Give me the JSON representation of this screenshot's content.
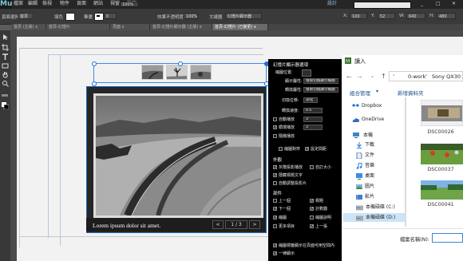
{
  "app": {
    "logo": "Mu"
  },
  "menubar": {
    "items": [
      "檔案",
      "編輯",
      "檢視",
      "物件",
      "頁面",
      "網站",
      "視窗",
      "說明"
    ],
    "workspace": "設計",
    "zoom": "100%",
    "right_field": "",
    "window_controls": [
      "_",
      "□",
      "✕"
    ]
  },
  "controlbar": {
    "page_label": "頁面選擇",
    "page_value": "首頁",
    "fill_label": "填色",
    "stroke_label": "筆畫",
    "stroke_value": "0",
    "effects_label": "效果",
    "opacity_label": "不透明度",
    "opacity_value": "100%",
    "wrap_label": "文繞圖",
    "widget_value": "幻燈片顯示器",
    "x_label": "X:",
    "x_value": "100",
    "y_label": "Y:",
    "y_value": "52",
    "w_label": "W:",
    "w_value": "640",
    "h_label": "H:",
    "h_value": "480"
  },
  "tabs": [
    "首頁 (主版) x",
    "首頁-幻燈片",
    "頁面 x",
    "首頁-幻燈片顯示器 (主版) x",
    "首頁-幻燈片 (已變更) x"
  ],
  "slideshow": {
    "caption": "Lorem ipsum dolor sit amet.",
    "counter": "1 / 3",
    "prev": "<",
    "next": ">"
  },
  "options": {
    "title": "幻燈片顯示器選項",
    "rows": [
      {
        "label": "縮圖位置:",
        "value": "上"
      },
      {
        "label": "顯示屬性:",
        "value": "僅限切換顯示縮圖"
      },
      {
        "label": "轉換屬性:",
        "value": "僅限切換顯示縮圖"
      },
      {
        "label": "切換位移:",
        "value": "淡化"
      },
      {
        "label": "轉換速度:",
        "value": "0.5"
      }
    ],
    "checks_top": [
      {
        "label": "自動播放",
        "value": "3",
        "checked": false
      },
      {
        "label": "循環播放",
        "value": "3",
        "checked": true
      },
      {
        "label": "隨機播放",
        "value": "",
        "checked": false
      }
    ],
    "checks_pair": [
      {
        "label": "縮圖對齊",
        "checked": false
      },
      {
        "label": "設定間距",
        "checked": true
      }
    ],
    "sec_appear": "外觀",
    "appear_items": [
      {
        "label": "灰階投影播放",
        "checked": true
      },
      {
        "label": "自訂大小",
        "checked": false
      },
      {
        "label": "隱藏標題文字",
        "checked": true
      },
      {
        "label": "自動調整投影片",
        "checked": false
      }
    ],
    "sec_parts": "部件",
    "parts": [
      {
        "label": "上一個",
        "checked": false
      },
      {
        "label": "標題",
        "checked": true
      },
      {
        "label": "下一個",
        "checked": true
      },
      {
        "label": "計數器",
        "checked": true
      },
      {
        "label": "縮圖",
        "checked": true
      },
      {
        "label": "縮圖說明",
        "checked": false
      },
      {
        "label": "更多項目",
        "checked": false
      },
      {
        "label": "上一張",
        "checked": true
      }
    ],
    "bottom": [
      {
        "label": "縮圖標籤顯示在頁面可用空間內",
        "checked": true
      },
      {
        "label": "一律顯示",
        "checked": true
      }
    ]
  },
  "dialog": {
    "title": "讀入",
    "path": [
      "0-work",
      "Sony QX30"
    ],
    "toolbar": {
      "organize": "組合管理",
      "new_folder": "新增資料夾"
    },
    "nav": [
      {
        "icon": "dropbox-icon",
        "label": "Dropbox"
      },
      {
        "icon": "onedrive-icon",
        "label": "OneDrive"
      },
      {
        "icon": "pc-icon",
        "label": "本機"
      },
      {
        "icon": "download-icon",
        "label": "下載"
      },
      {
        "icon": "document-icon",
        "label": "文件"
      },
      {
        "icon": "music-icon",
        "label": "音樂"
      },
      {
        "icon": "desktop-icon",
        "label": "桌面"
      },
      {
        "icon": "picture-icon",
        "label": "圖片"
      },
      {
        "icon": "video-icon",
        "label": "影片"
      },
      {
        "icon": "disk-icon",
        "label": "本機磁碟 (C:)"
      },
      {
        "icon": "disk-icon",
        "label": "本機磁碟 (D:)"
      }
    ],
    "files": [
      "DSC00026",
      "DSC00037",
      "DSC00041"
    ],
    "filename_label": "檔案名稱(N):",
    "filename_value": ""
  }
}
